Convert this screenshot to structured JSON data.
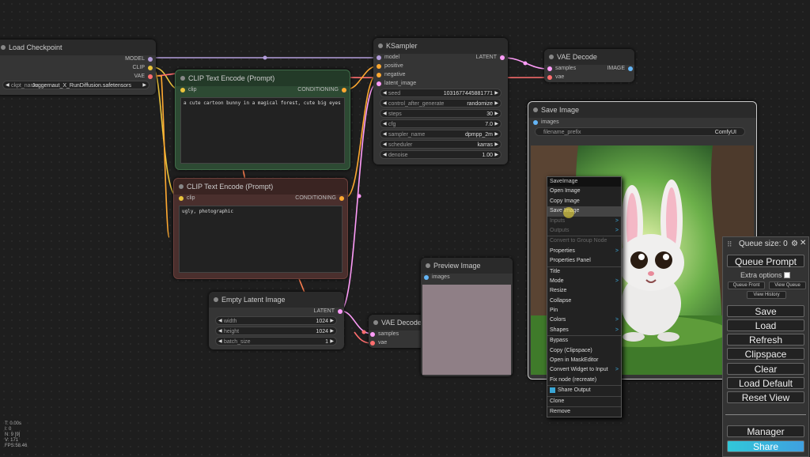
{
  "colors": {
    "clip": "#e9c33c",
    "model": "#b39ddb",
    "latent": "#ff9cf9",
    "vae": "#ff6e6e",
    "conditioning": "#ffa931",
    "image": "#64b5f6"
  },
  "load_checkpoint": {
    "title": "Load Checkpoint",
    "outputs": [
      "MODEL",
      "CLIP",
      "VAE"
    ],
    "ckpt_label": "ckpt_name",
    "ckpt_value": "Juggernaut_X_RunDiffusion.safetensors"
  },
  "clip_pos": {
    "title": "CLIP Text Encode (Prompt)",
    "input": "clip",
    "output": "CONDITIONING",
    "text": "a cute cartoon bunny in a magical forest, cute big eyes"
  },
  "clip_neg": {
    "title": "CLIP Text Encode (Prompt)",
    "input": "clip",
    "output": "CONDITIONING",
    "text": "ugly, photographic"
  },
  "ksampler": {
    "title": "KSampler",
    "inputs": [
      "model",
      "positive",
      "negative",
      "latent_image"
    ],
    "output": "LATENT",
    "widgets": [
      {
        "label": "seed",
        "value": "1031677445881771"
      },
      {
        "label": "control_after_generate",
        "value": "randomize"
      },
      {
        "label": "steps",
        "value": "30"
      },
      {
        "label": "cfg",
        "value": "7.0"
      },
      {
        "label": "sampler_name",
        "value": "dpmpp_2m"
      },
      {
        "label": "scheduler",
        "value": "karras"
      },
      {
        "label": "denoise",
        "value": "1.00"
      }
    ]
  },
  "vae_decode_top": {
    "title": "VAE Decode",
    "inputs": [
      "samples",
      "vae"
    ],
    "output": "IMAGE"
  },
  "vae_decode_bottom": {
    "title": "VAE Decode",
    "inputs": [
      "samples",
      "vae"
    ]
  },
  "empty_latent": {
    "title": "Empty Latent Image",
    "output": "LATENT",
    "widgets": [
      {
        "label": "width",
        "value": "1024"
      },
      {
        "label": "height",
        "value": "1024"
      },
      {
        "label": "batch_size",
        "value": "1"
      }
    ]
  },
  "preview_image": {
    "title": "Preview Image",
    "input": "images"
  },
  "save_image": {
    "title": "Save Image",
    "input": "images",
    "prefix_label": "filename_prefix",
    "prefix_value": "ComfyUI"
  },
  "context_menu": {
    "items": [
      {
        "label": "SaveImage",
        "kind": "title"
      },
      {
        "label": "Open Image"
      },
      {
        "label": "Copy Image"
      },
      {
        "label": "Save Image",
        "kind": "hl"
      },
      {
        "label": "Inputs",
        "kind": "dis",
        "sub": true
      },
      {
        "label": "Outputs",
        "kind": "dis",
        "sub": true
      },
      {
        "label": "Convert to Group Node",
        "kind": "dis",
        "sep": true
      },
      {
        "label": "Properties",
        "sub": true
      },
      {
        "label": "Properties Panel"
      },
      {
        "label": "Title",
        "sep": true
      },
      {
        "label": "Mode",
        "sub": true
      },
      {
        "label": "Resize"
      },
      {
        "label": "Collapse"
      },
      {
        "label": "Pin"
      },
      {
        "label": "Colors",
        "sub": true
      },
      {
        "label": "Shapes",
        "sub": true
      },
      {
        "label": "Bypass",
        "sep": true
      },
      {
        "label": "Copy (Clipspace)"
      },
      {
        "label": "Open in MaskEditor"
      },
      {
        "label": "Convert Widget to Input",
        "sub": true
      },
      {
        "label": "Fix node (recreate)"
      },
      {
        "label": "Share Output",
        "sep": true,
        "icon": true
      },
      {
        "label": "Clone",
        "sep": true
      },
      {
        "label": "Remove",
        "sep": true
      }
    ]
  },
  "queue_panel": {
    "queue_size": "Queue size: 0",
    "queue_prompt": "Queue Prompt",
    "extra_options": "Extra options",
    "queue_front": "Queue Front",
    "view_queue": "View Queue",
    "view_history": "View History",
    "buttons": [
      "Save",
      "Load",
      "Refresh",
      "Clipspace",
      "Clear",
      "Load Default",
      "Reset View"
    ],
    "manager": "Manager",
    "share": "Share"
  },
  "stats": [
    "T: 0.00s",
    "I: 0",
    "N: 9 [9]",
    "V: 171",
    "FPS:58.46"
  ]
}
